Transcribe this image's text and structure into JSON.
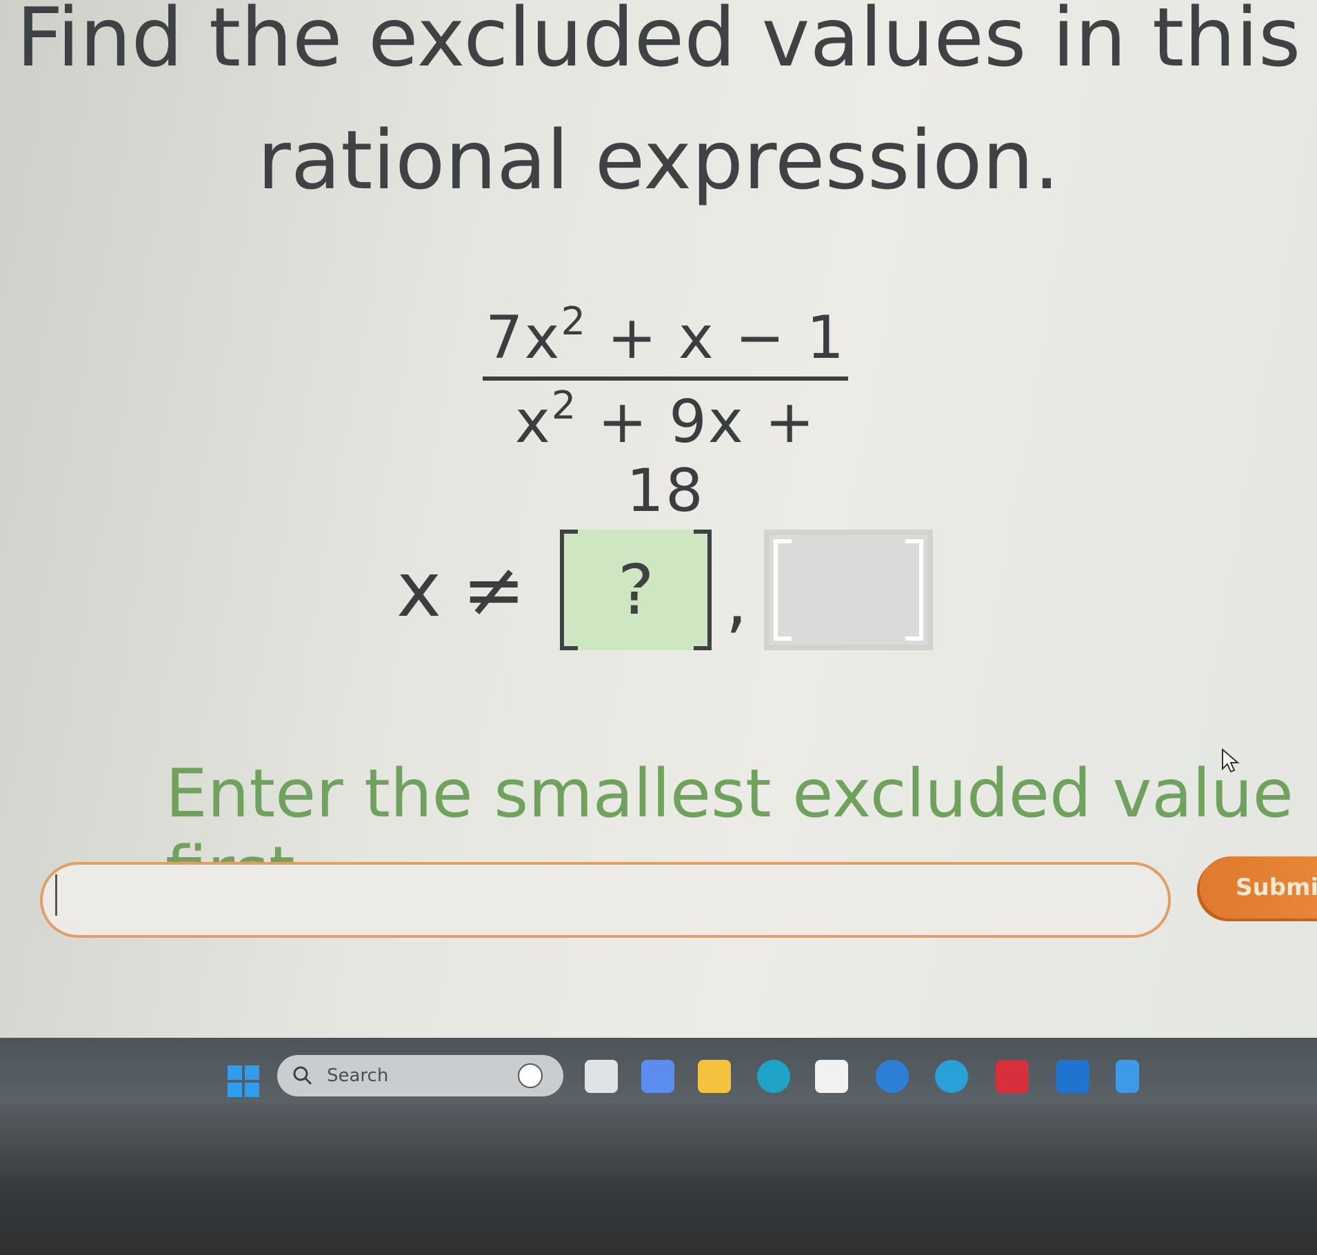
{
  "question": {
    "title_line1": "Find the excluded values in this",
    "title_line2": "rational expression."
  },
  "expression": {
    "numerator_coef": "7x",
    "numerator_exp": "2",
    "numerator_rest": " + x − 1",
    "denominator_base": "x",
    "denominator_exp": "2",
    "denominator_rest": " + 9x + 18"
  },
  "answer": {
    "variable": "x",
    "relation": "≠",
    "slot1_placeholder": "?",
    "separator": ",",
    "input_value": ""
  },
  "instruction": "Enter the smallest excluded value first.",
  "submit_label": "Submit",
  "taskbar": {
    "search_placeholder": "Search",
    "icons": [
      {
        "name": "start-icon",
        "color": "#2f9ef0"
      },
      {
        "name": "task-view-icon",
        "color": "#dfe3e6"
      },
      {
        "name": "copilot-icon",
        "color": "#5b8def"
      },
      {
        "name": "file-explorer-icon",
        "color": "#f4c23d"
      },
      {
        "name": "edge-icon",
        "color": "#1fa3c9"
      },
      {
        "name": "store-icon",
        "color": "#f1f1f1"
      },
      {
        "name": "hp-icon",
        "color": "#2d7fd6"
      },
      {
        "name": "help-icon",
        "color": "#2a9fd8"
      },
      {
        "name": "mcafee-icon",
        "color": "#d7303c"
      },
      {
        "name": "outlook-icon",
        "color": "#1f74d0"
      },
      {
        "name": "pen-icon",
        "color": "#3d9ae8"
      }
    ]
  },
  "colors": {
    "instruction": "#6fa35d",
    "slot_active": "#cfe6c2",
    "input_border": "#e29e63",
    "submit": "#e07a2e",
    "taskbar": "#4c5459"
  }
}
